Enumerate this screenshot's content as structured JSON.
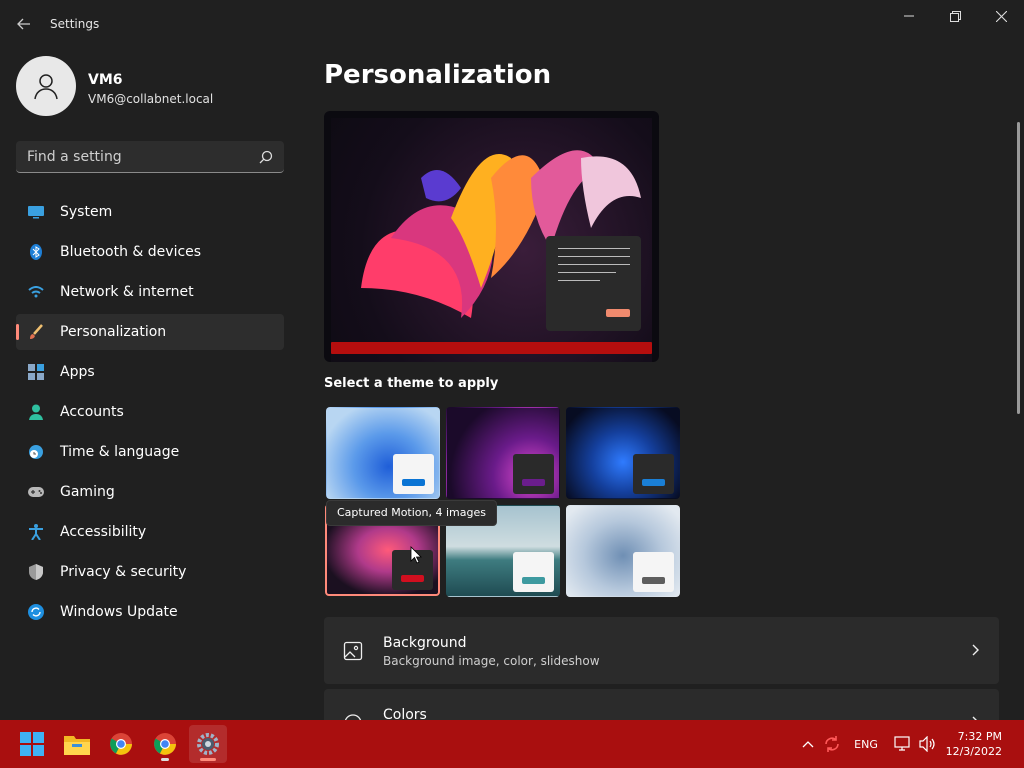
{
  "window": {
    "app_title": "Settings"
  },
  "user": {
    "name": "VM6",
    "email": "VM6@collabnet.local"
  },
  "search": {
    "placeholder": "Find a setting"
  },
  "sidebar": {
    "items": [
      {
        "label": "System",
        "icon": "system-icon"
      },
      {
        "label": "Bluetooth & devices",
        "icon": "bluetooth-icon"
      },
      {
        "label": "Network & internet",
        "icon": "wifi-icon"
      },
      {
        "label": "Personalization",
        "icon": "brush-icon",
        "active": true
      },
      {
        "label": "Apps",
        "icon": "apps-icon"
      },
      {
        "label": "Accounts",
        "icon": "person-icon"
      },
      {
        "label": "Time & language",
        "icon": "globe-clock-icon"
      },
      {
        "label": "Gaming",
        "icon": "gamepad-icon"
      },
      {
        "label": "Accessibility",
        "icon": "accessibility-icon"
      },
      {
        "label": "Privacy & security",
        "icon": "shield-icon"
      },
      {
        "label": "Windows Update",
        "icon": "update-icon"
      }
    ]
  },
  "main": {
    "title": "Personalization",
    "themes_heading": "Select a theme to apply",
    "tooltip": "Captured Motion, 4 images",
    "themes": [
      {
        "id": "windows-light",
        "accent": "#0a74d4"
      },
      {
        "id": "glow",
        "accent": "#6a1d8c"
      },
      {
        "id": "windows-dark",
        "accent": "#1a7fd6"
      },
      {
        "id": "captured-motion",
        "accent": "#d10f1f",
        "selected": true
      },
      {
        "id": "flow",
        "accent": "#3d9aa0"
      },
      {
        "id": "sunrise",
        "accent": "#5e5e5e"
      }
    ],
    "cards": [
      {
        "title": "Background",
        "subtitle": "Background image, color, slideshow"
      },
      {
        "title": "Colors",
        "subtitle": ""
      }
    ]
  },
  "taskbar": {
    "apps": [
      "start-icon",
      "file-explorer-icon",
      "chrome-icon",
      "chrome-icon",
      "settings-icon"
    ],
    "lang": "ENG",
    "time": "7:32 PM",
    "date": "12/3/2022"
  },
  "colors": {
    "accent": "#ff8a7a",
    "taskbar": "#a90f0f",
    "background": "#202020",
    "card": "#2b2b2b"
  }
}
